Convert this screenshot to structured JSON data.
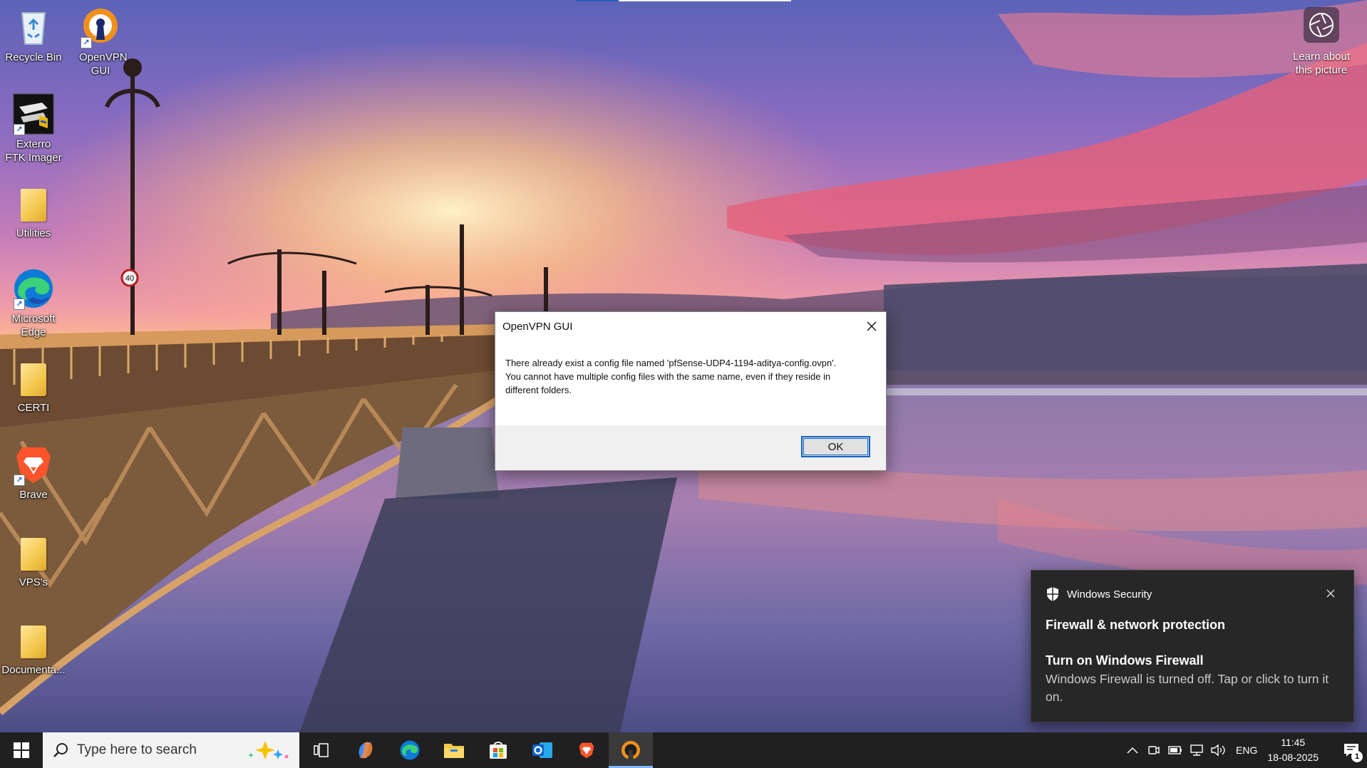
{
  "desktop": {
    "icons": [
      {
        "label": "Recycle Bin",
        "icon": "recycle-bin-icon"
      },
      {
        "label": "OpenVPN GUI",
        "icon": "openvpn-icon"
      },
      {
        "label": "Exterro FTK Imager",
        "icon": "ftk-imager-icon"
      },
      {
        "label": "Utilities",
        "icon": "folder-icon"
      },
      {
        "label": "Microsoft Edge",
        "icon": "edge-icon"
      },
      {
        "label": "CERTI",
        "icon": "folder-icon"
      },
      {
        "label": "Brave",
        "icon": "brave-icon"
      },
      {
        "label": "VPS's",
        "icon": "folder-icon"
      },
      {
        "label": "Documenta...",
        "icon": "folder-icon"
      }
    ],
    "learn_about_picture": "Learn about\nthis picture"
  },
  "dialog": {
    "title": "OpenVPN GUI",
    "message": "There already exist a config file named 'pfSense-UDP4-1194-aditya-config.ovpn'.\nYou cannot have multiple config files with the same name, even if they reside in\ndifferent folders.",
    "ok_label": "OK"
  },
  "notification": {
    "app": "Windows Security",
    "title": "Firewall & network protection",
    "subtitle": "Turn on Windows Firewall",
    "message": "Windows Firewall is turned off. Tap or click to turn it on."
  },
  "taskbar": {
    "search_placeholder": "Type here to search",
    "apps": [
      {
        "name": "task-view"
      },
      {
        "name": "copilot"
      },
      {
        "name": "edge"
      },
      {
        "name": "file-explorer"
      },
      {
        "name": "microsoft-store"
      },
      {
        "name": "outlook"
      },
      {
        "name": "brave"
      },
      {
        "name": "openvpn",
        "active": true
      }
    ],
    "tray": {
      "language": "ENG",
      "time": "11:45",
      "date": "18-08-2025",
      "notification_count": "1"
    }
  },
  "colors": {
    "taskbar_bg": "#202020",
    "accent": "#0f62c8",
    "toast_bg": "#272727"
  }
}
